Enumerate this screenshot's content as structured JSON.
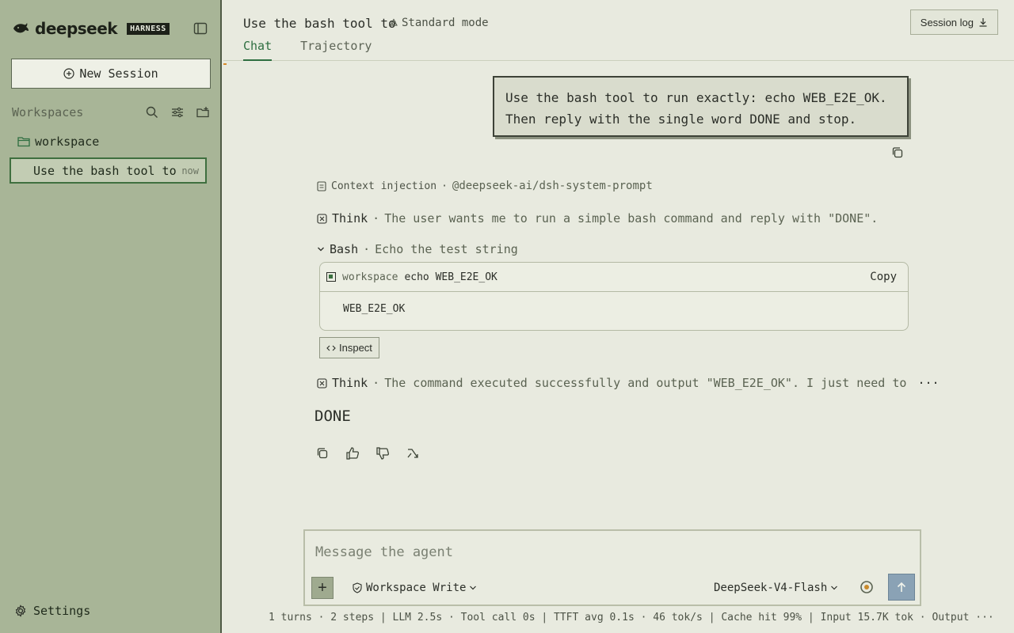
{
  "brand": {
    "name": "deepseek",
    "badge": "HARNESS"
  },
  "sidebar": {
    "new_session_label": "New Session",
    "workspaces_title": "Workspaces",
    "folder_label": "workspace",
    "session": {
      "label": "Use the bash tool to",
      "time": "now"
    },
    "settings_label": "Settings"
  },
  "header": {
    "title": "Use the bash tool to",
    "mode": "Standard mode",
    "session_log_label": "Session log",
    "tabs": [
      {
        "label": "Chat"
      },
      {
        "label": "Trajectory"
      }
    ]
  },
  "chat": {
    "user_message_line1": "Use the bash tool to run exactly: echo WEB_E2E_OK.",
    "user_message_line2": "Then reply with the single word DONE and stop.",
    "context": {
      "label": "Context injection",
      "source": "@deepseek-ai/dsh-system-prompt"
    },
    "think1": {
      "label": "Think",
      "text": "The user wants me to run a simple bash command and reply with \"DONE\"."
    },
    "bash": {
      "label": "Bash",
      "description": "Echo the test string",
      "cwd": "workspace",
      "command": "echo WEB_E2E_OK",
      "copy_label": "Copy",
      "output": "WEB_E2E_OK"
    },
    "inspect_label": "Inspect",
    "think2": {
      "label": "Think",
      "text": "The command executed successfully and output \"WEB_E2E_OK\". I just need to"
    },
    "more": "···",
    "reply": "DONE"
  },
  "composer": {
    "placeholder": "Message the agent",
    "plus": "+",
    "permission": "Workspace Write",
    "model": "DeepSeek-V4-Flash"
  },
  "footer": {
    "stats": "1 turns · 2 steps | LLM 2.5s · Tool call 0s | TTFT avg 0.1s · 46 tok/s | Cache hit 99% | Input 15.7K tok · Output ···"
  }
}
